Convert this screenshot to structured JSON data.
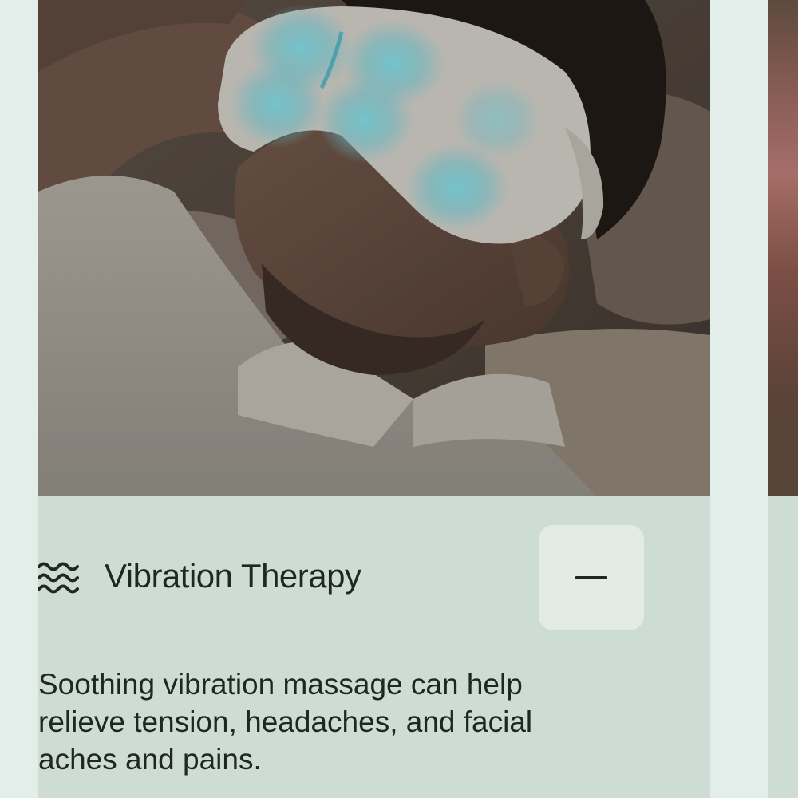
{
  "feature": {
    "title": "Vibration Therapy",
    "description": "Soothing vibration massage can help relieve tension, headaches, and facial aches and pains.",
    "icon": "waves-icon",
    "toggle_icon": "minus-icon",
    "expanded": true
  },
  "colors": {
    "page_background": "#e3ede9",
    "card_background": "#ceddd4",
    "button_background": "#e2ebe6",
    "text": "#1f2623",
    "mask_glow": "#68c9d4"
  }
}
